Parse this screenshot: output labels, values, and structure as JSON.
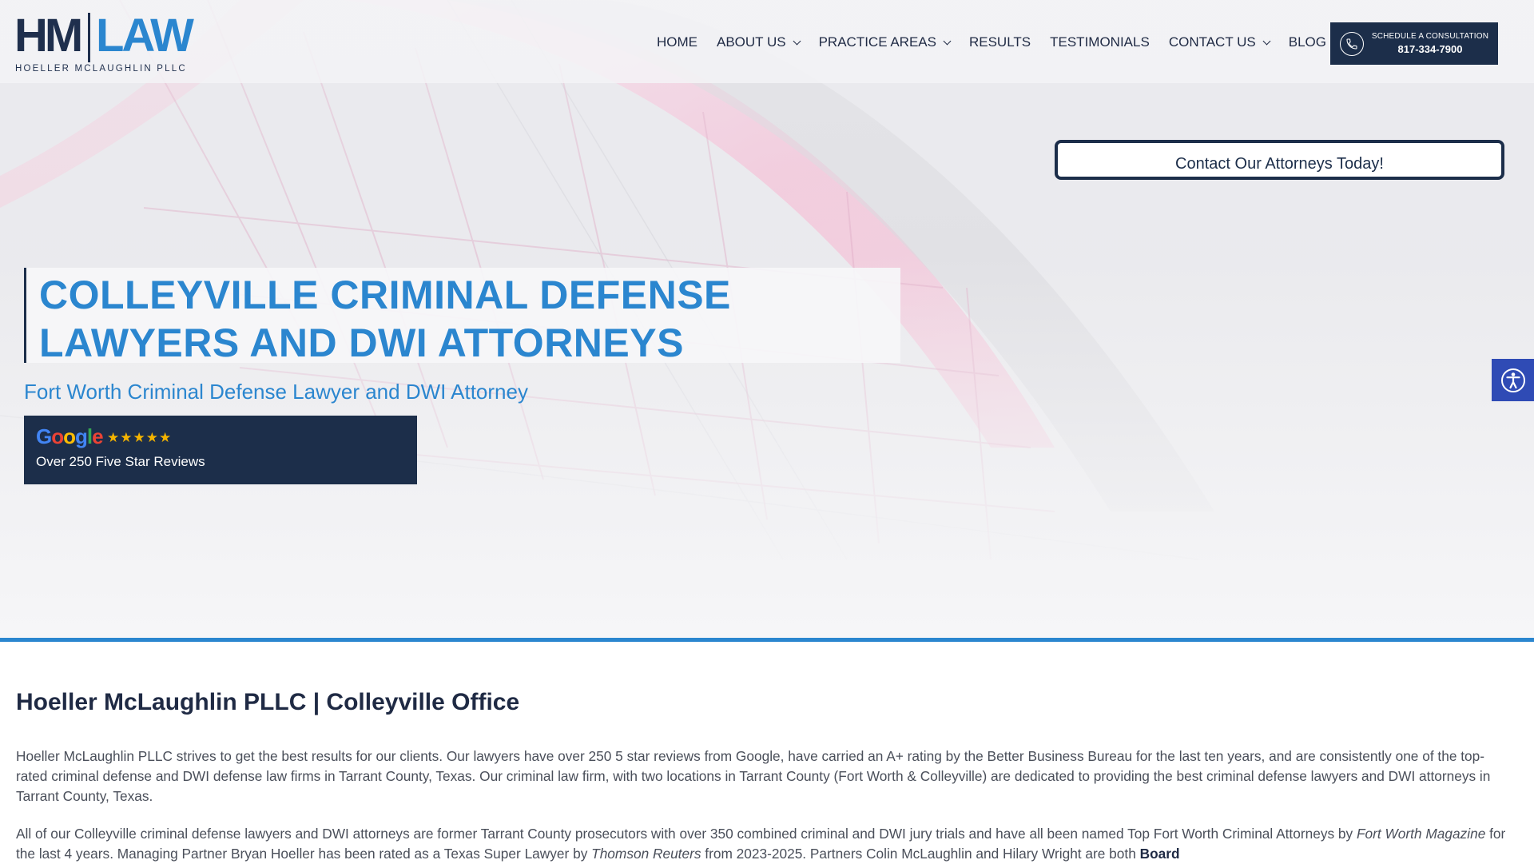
{
  "logo": {
    "mark_left": "HM",
    "mark_right": "LAW",
    "firm_name": "HOELLER MCLAUGHLIN PLLC"
  },
  "nav": {
    "items": [
      {
        "label": "HOME",
        "dropdown": false
      },
      {
        "label": "ABOUT US",
        "dropdown": true
      },
      {
        "label": "PRACTICE AREAS",
        "dropdown": true
      },
      {
        "label": "RESULTS",
        "dropdown": false
      },
      {
        "label": "TESTIMONIALS",
        "dropdown": false
      },
      {
        "label": "CONTACT US",
        "dropdown": true
      },
      {
        "label": "BLOG",
        "dropdown": false
      }
    ]
  },
  "cta": {
    "label": "SCHEDULE A CONSULTATION",
    "phone": "817-334-7900",
    "icon": "phone-icon"
  },
  "hero": {
    "contact_button": "Contact Our Attorneys Today!",
    "title_line1": "COLLEYVILLE CRIMINAL DEFENSE",
    "title_line2": "LAWYERS AND DWI ATTORNEYS",
    "subtitle": "Fort Worth Criminal Defense Lawyer and DWI Attorney",
    "reviews": {
      "brand": "Google",
      "stars": "★★★★★",
      "rating": 5,
      "text": "Over 250 Five Star Reviews"
    }
  },
  "accessibility": {
    "icon": "accessibility-icon"
  },
  "content": {
    "heading": "Hoeller McLaughlin PLLC | Colleyville Office",
    "p1": "Hoeller McLaughlin PLLC strives to get the best results for our clients.  Our lawyers have over 250 5 star reviews from Google, have carried an A+ rating by the Better Business Bureau for the last ten years, and are consistently one of the top-rated criminal defense and DWI defense law firms in Tarrant County, Texas. Our criminal law firm, with two locations in Tarrant County (Fort Worth & Colleyville) are dedicated to providing the best criminal defense lawyers and DWI attorneys in Tarrant County, Texas.",
    "p2_a": "All of our Colleyville criminal defense lawyers and DWI attorneys are former Tarrant County prosecutors with over 350 combined criminal and DWI jury trials and have all been named Top Fort Worth Criminal Attorneys by ",
    "p2_b": "Fort Worth Magazine",
    "p2_c": " for the last 4 years. Managing Partner Bryan Hoeller has been rated as a Texas Super Lawyer by ",
    "p2_d": "Thomson Reuters",
    "p2_e": " from 2023-2025.  Partners Colin McLaughlin and Hilary Wright are both ",
    "p2_f": "Board"
  },
  "colors": {
    "navy": "#1c2e4a",
    "brand_blue": "#2b86cf",
    "accessibility_blue": "#2f4bb5",
    "star_gold": "#f5b400"
  }
}
